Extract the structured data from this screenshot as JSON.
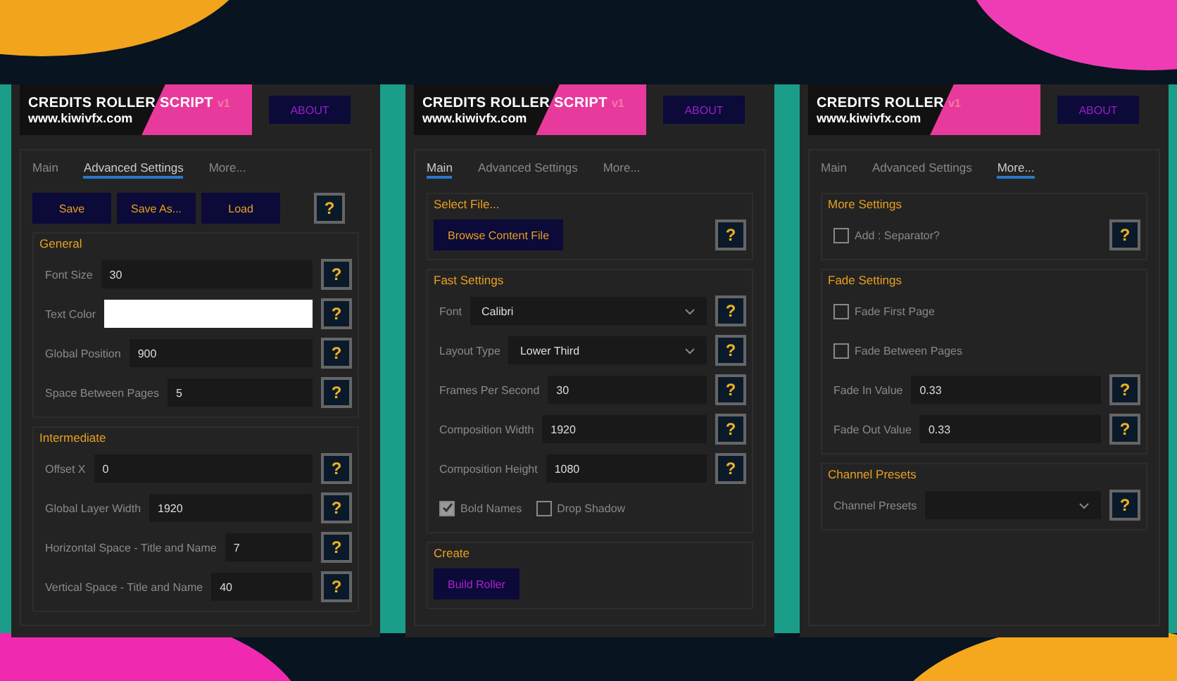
{
  "panels": [
    {
      "logo": {
        "title": "CREDITS ROLLER SCRIPT",
        "version": "v1",
        "url": "www.kiwivfx.com"
      },
      "about": {
        "label": "ABOUT",
        "color": "#9a1fc8"
      },
      "tabs": [
        {
          "label": "Main",
          "selected": false
        },
        {
          "label": "Advanced Settings",
          "selected": true
        },
        {
          "label": "More...",
          "selected": false
        }
      ],
      "sections": [
        {
          "items": [
            {
              "kind": "buttons",
              "buttons": [
                {
                  "label": "Save",
                  "color": "#e8a020"
                },
                {
                  "label": "Save As...",
                  "color": "#e8a020"
                },
                {
                  "label": "Load",
                  "color": "#e8a020"
                }
              ],
              "help": "?"
            }
          ]
        },
        {
          "title": "General",
          "items": [
            {
              "kind": "text",
              "label": "Font Size",
              "value": "30",
              "help": "?"
            },
            {
              "kind": "color",
              "label": "Text Color",
              "color": "#ffffff",
              "help": "?"
            },
            {
              "kind": "text",
              "label": "Global Position",
              "value": "900",
              "help": "?"
            },
            {
              "kind": "text",
              "label": "Space Between Pages",
              "value": "5",
              "help": "?"
            }
          ]
        },
        {
          "title": "Intermediate",
          "items": [
            {
              "kind": "text",
              "label": "Offset X",
              "value": "0",
              "help": "?"
            },
            {
              "kind": "text",
              "label": "Global Layer Width",
              "value": "1920",
              "help": "?"
            },
            {
              "kind": "text",
              "label": "Horizontal Space - Title and Name",
              "value": "7",
              "help": "?"
            },
            {
              "kind": "text",
              "label": "Vertical Space - Title and Name",
              "value": "40",
              "help": "?"
            }
          ]
        }
      ]
    },
    {
      "logo": {
        "title": "CREDITS ROLLER SCRIPT",
        "version": "v1",
        "url": "www.kiwivfx.com"
      },
      "about": {
        "label": "ABOUT",
        "color": "#9a1fc8"
      },
      "tabs": [
        {
          "label": "Main",
          "selected": true
        },
        {
          "label": "Advanced Settings",
          "selected": false
        },
        {
          "label": "More...",
          "selected": false
        }
      ],
      "sections": [
        {
          "title": "Select File...",
          "items": [
            {
              "kind": "buttons",
              "buttons": [
                {
                  "label": "Browse Content File",
                  "color": "#e8a020"
                }
              ],
              "help": "?"
            }
          ]
        },
        {
          "title": "Fast Settings",
          "items": [
            {
              "kind": "select",
              "label": "Font",
              "value": "Calibri",
              "help": "?"
            },
            {
              "kind": "select",
              "label": "Layout Type",
              "value": "Lower Third",
              "help": "?"
            },
            {
              "kind": "text",
              "label": "Frames Per Second",
              "value": "30",
              "help": "?"
            },
            {
              "kind": "text",
              "label": "Composition Width",
              "value": "1920",
              "help": "?"
            },
            {
              "kind": "text",
              "label": "Composition Height",
              "value": "1080",
              "help": "?"
            },
            {
              "kind": "checkboxes",
              "options": [
                {
                  "label": "Bold Names",
                  "checked": true
                },
                {
                  "label": "Drop Shadow",
                  "checked": false
                }
              ]
            }
          ]
        },
        {
          "title": "Create",
          "items": [
            {
              "kind": "buttons",
              "buttons": [
                {
                  "label": "Build Roller",
                  "color": "#b020d0"
                }
              ]
            }
          ]
        }
      ]
    },
    {
      "logo": {
        "title": "CREDITS ROLLER",
        "version": "v1",
        "url": "www.kiwivfx.com"
      },
      "about": {
        "label": "ABOUT",
        "color": "#9a1fc8"
      },
      "tabs": [
        {
          "label": "Main",
          "selected": false
        },
        {
          "label": "Advanced Settings",
          "selected": false
        },
        {
          "label": "More...",
          "selected": true
        }
      ],
      "sections": [
        {
          "title": "More Settings",
          "items": [
            {
              "kind": "checkboxes",
              "options": [
                {
                  "label": "Add : Separator?",
                  "checked": false
                }
              ],
              "help": "?"
            }
          ]
        },
        {
          "title": "Fade Settings",
          "items": [
            {
              "kind": "checkboxes",
              "options": [
                {
                  "label": "Fade First Page",
                  "checked": false
                }
              ]
            },
            {
              "kind": "checkboxes",
              "options": [
                {
                  "label": "Fade Between Pages",
                  "checked": false
                }
              ]
            },
            {
              "kind": "text",
              "label": "Fade In Value",
              "value": "0.33",
              "help": "?"
            },
            {
              "kind": "text",
              "label": "Fade Out Value",
              "value": "0.33",
              "help": "?"
            }
          ]
        },
        {
          "title": "Channel Presets",
          "items": [
            {
              "kind": "select",
              "label": "Channel Presets",
              "help": "?"
            }
          ]
        }
      ]
    }
  ]
}
